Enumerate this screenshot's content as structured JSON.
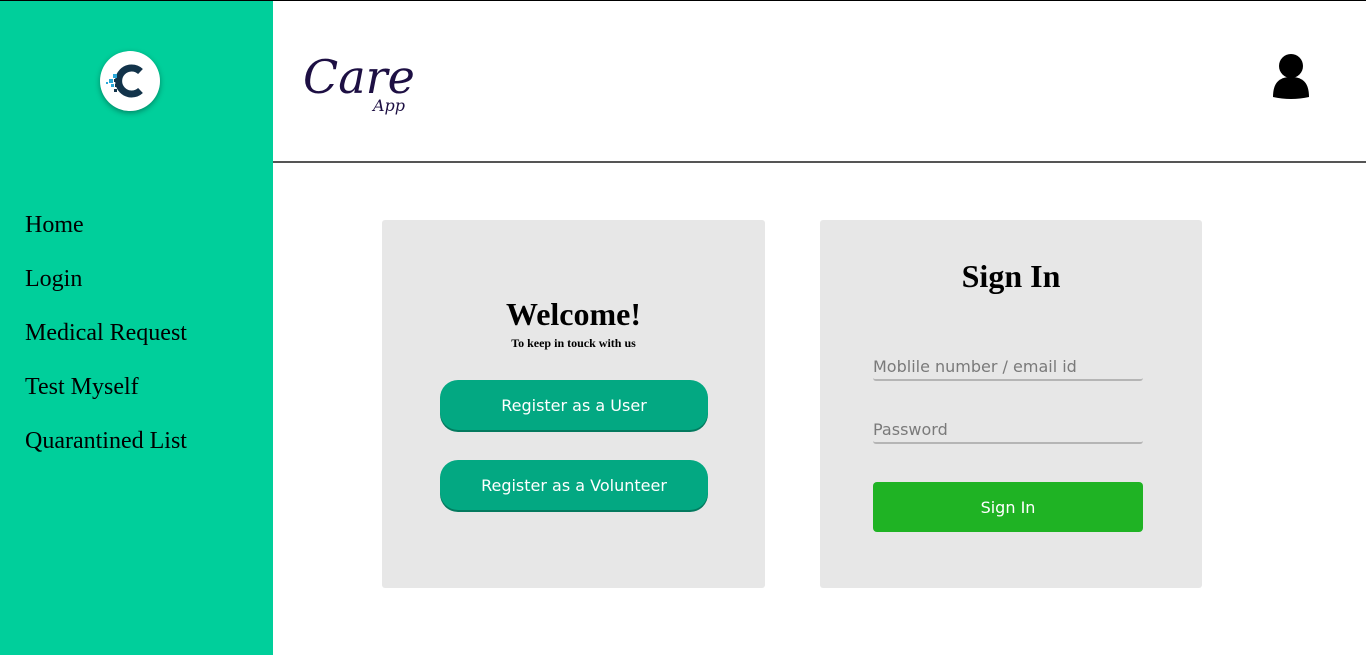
{
  "colors": {
    "sidebar": "#00cf9b",
    "register_button": "#03a882",
    "signin_button": "#1fb324",
    "card": "#e7e7e7",
    "brand_text": "#1d0f43"
  },
  "sidebar": {
    "logo_icon": "care-app-c-logo-icon",
    "items": [
      {
        "label": "Home"
      },
      {
        "label": "Login"
      },
      {
        "label": "Medical Request"
      },
      {
        "label": "Test Myself"
      },
      {
        "label": "Quarantined List"
      }
    ]
  },
  "header": {
    "brand": "Care",
    "brand_sub": "App",
    "user_icon": "user-icon"
  },
  "welcome": {
    "title": "Welcome!",
    "subtitle": "To keep in touck with us",
    "register_user": "Register as a User",
    "register_volunteer": "Register as a Volunteer"
  },
  "signin": {
    "title": "Sign In",
    "username_placeholder": "Moblile number / email id",
    "username_value": "",
    "password_placeholder": "Password",
    "password_value": "",
    "button": "Sign In"
  }
}
